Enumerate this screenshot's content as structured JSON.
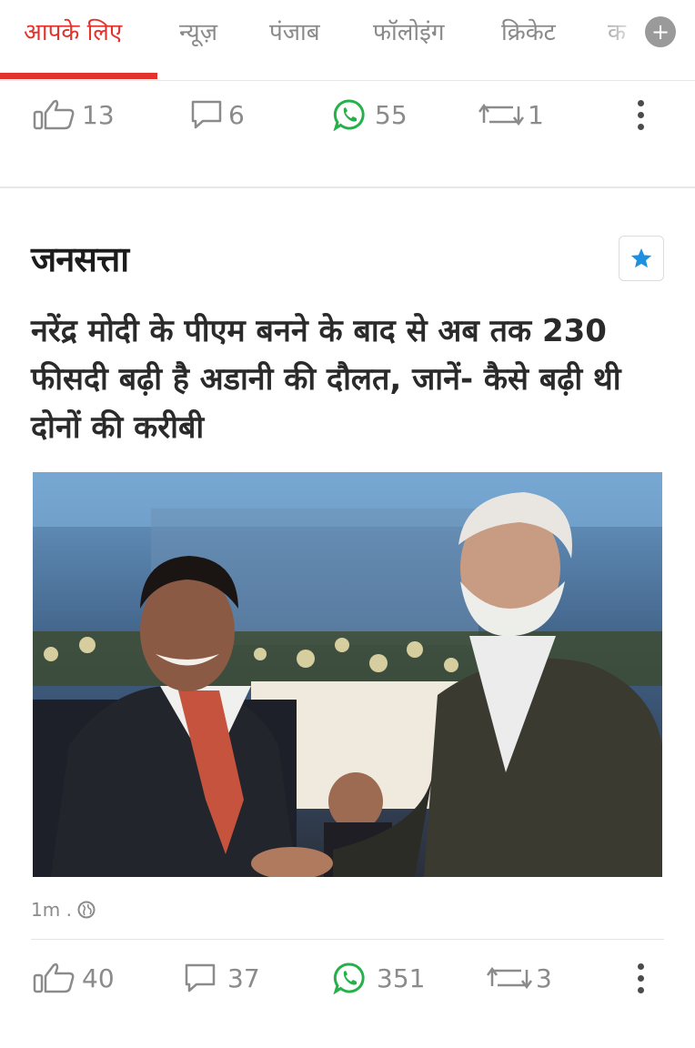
{
  "tabs": {
    "items": [
      {
        "label": "आपके लिए"
      },
      {
        "label": "न्यूज़"
      },
      {
        "label": "पंजाब"
      },
      {
        "label": "फॉलोइंग"
      },
      {
        "label": "क्रिकेट"
      },
      {
        "label": "क"
      }
    ],
    "add_label": "+"
  },
  "prev_actions": {
    "like_count": "13",
    "comment_count": "6",
    "whatsapp_count": "55",
    "repost_count": "1"
  },
  "card": {
    "source": "जनसत्ता",
    "headline": "नरेंद्र मोदी के पीएम बनने के बाद से अब तक 230 फीसदी बढ़ी है अडानी की दौलत, जानें- कैसे बढ़ी थी दोनों की करीबी",
    "time": "1m .",
    "actions": {
      "like_count": "40",
      "comment_count": "37",
      "whatsapp_count": "351",
      "repost_count": "3"
    }
  },
  "colors": {
    "accent": "#e2332c",
    "whatsapp": "#25b14a",
    "star": "#1f8fe0"
  }
}
